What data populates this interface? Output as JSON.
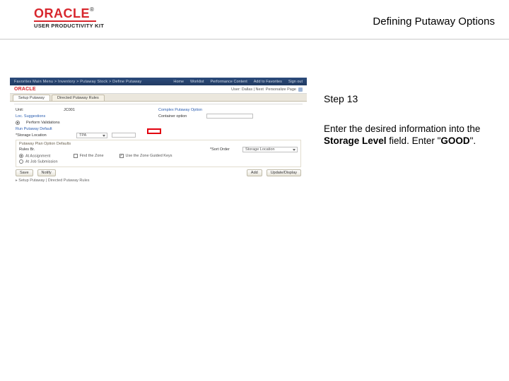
{
  "header": {
    "logo_text": "ORACLE",
    "logo_sub": "USER PRODUCTIVITY KIT",
    "page_title": "Defining Putaway Options"
  },
  "right": {
    "step": "Step 13",
    "instruction_pre": "Enter the desired information into the ",
    "instruction_field": "Storage Level",
    "instruction_mid": " field. Enter \"",
    "instruction_value": "GOOD",
    "instruction_post": "\"."
  },
  "app": {
    "topbar_left": "Favorites    Main Menu  >  Inventory  >  Putaway Stock  >  Define Putaway",
    "topbar_links": [
      "Home",
      "Worklist",
      "Performance Content",
      "Add to Favorites",
      "Sign out"
    ],
    "brand": "ORACLE",
    "user_label": "User: Dallas |  Next",
    "personalize": "Personalize Page",
    "tabs": [
      "Setup Putaway",
      "Directed Putaway Rules"
    ],
    "form": {
      "unit_label": "Unit:",
      "unit_value": "JC001",
      "complex_label": "Complex Putaway Option",
      "loc_label": "Loc. Suggestions",
      "perform_label": "Perform Validations",
      "container_label": "Container option",
      "run_label": "Run Putaway Default",
      "storage_label": "*Storage Location",
      "tpa_value": "TPA",
      "section_title": "Putaway Plan Option Defaults",
      "rules_label": "Rules Br.",
      "sort_label": "*Sort Order",
      "sort_value": "Storage Location",
      "radio1": "At Assignment",
      "radio2": "At Job Submission",
      "chk1": "Find the Zone",
      "chk2": "Use the Zone Guided Keys",
      "btn_save": "Save",
      "btn_notify": "Notify",
      "btn_add": "Add",
      "btn_update": "Update/Display",
      "status": "Setup Putaway | Directed Putaway Rules"
    }
  }
}
